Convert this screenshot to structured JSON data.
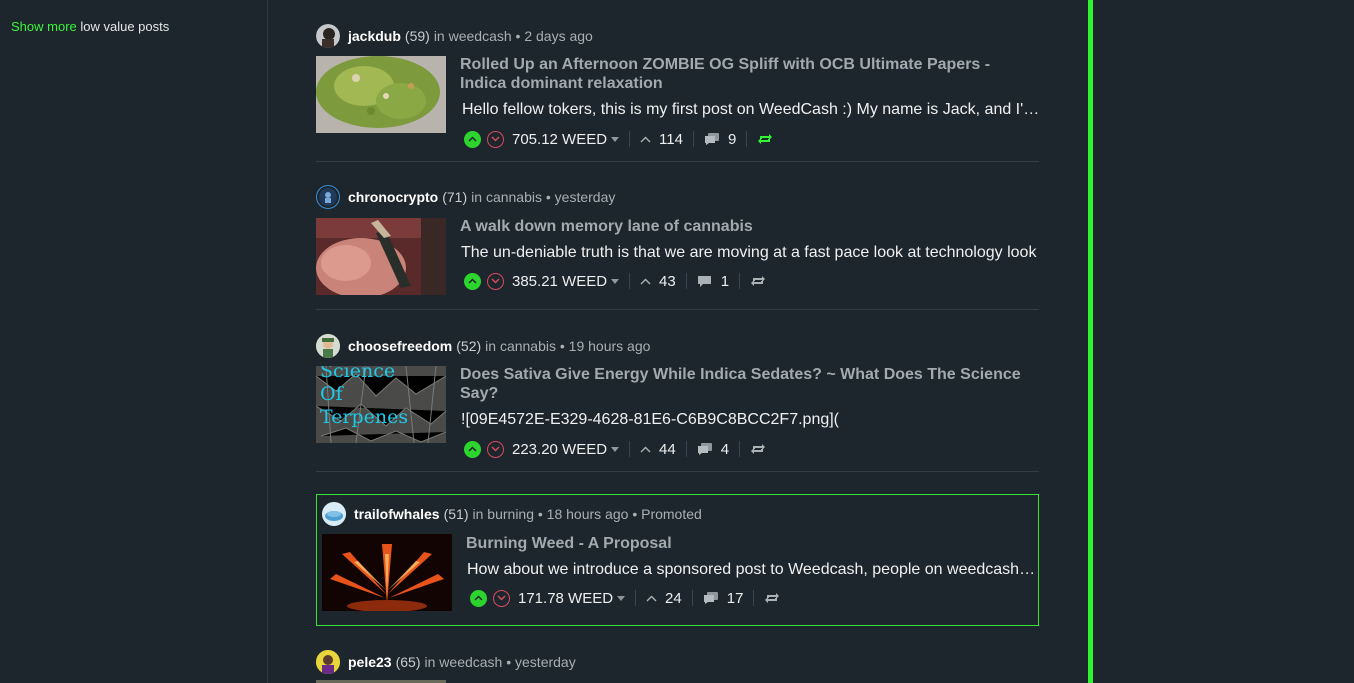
{
  "sidebar": {
    "show_more_link": "Show more",
    "show_more_rest": " low value posts"
  },
  "posts": [
    {
      "author": "jackdub",
      "rep": "(59)",
      "in_label": "in",
      "community": "weedcash",
      "time": "• 2 days ago",
      "title": "Rolled Up an Afternoon ZOMBIE OG Spliff with OCB Ultimate Papers - Indica dominant relaxation",
      "body": "Hello fellow tokers, this is my first post on WeedCash :) My name is Jack, and I'm a",
      "payout": "705.12 WEED",
      "votes": "114",
      "comments": "9",
      "reblogged": true
    },
    {
      "author": "chronocrypto",
      "rep": "(71)",
      "in_label": "in",
      "community": "cannabis",
      "time": "• yesterday",
      "title": "A walk down memory lane of cannabis",
      "body": "The un-deniable truth is that we are moving at a fast pace look at technology look",
      "payout": "385.21 WEED",
      "votes": "43",
      "comments": "1",
      "reblogged": false
    },
    {
      "author": "choosefreedom",
      "rep": "(52)",
      "in_label": "in",
      "community": "cannabis",
      "time": "• 19 hours ago",
      "title": "Does Sativa Give Energy While Indica Sedates? ~ What Does The Science Say?",
      "body": "![09E4572E-E329-4628-81E6-C6B9C8BCC2F7.png](",
      "thumb_text": "Science Of Terpenes",
      "payout": "223.20 WEED",
      "votes": "44",
      "comments": "4",
      "reblogged": false
    },
    {
      "author": "trailofwhales",
      "rep": "(51)",
      "in_label": "in",
      "community": "burning",
      "time": "• 18 hours ago",
      "promoted": "• Promoted",
      "title": "Burning Weed - A Proposal",
      "body": "How about we introduce a sponsored post to Weedcash, people on weedcash can",
      "payout": "171.78 WEED",
      "votes": "24",
      "comments": "17",
      "reblogged": false
    },
    {
      "author": "pele23",
      "rep": "(65)",
      "in_label": "in",
      "community": "weedcash",
      "time": "• yesterday"
    }
  ],
  "colors": {
    "background": "#1c262c",
    "accent_green": "#2ff42f",
    "upvote": "#2ed42e",
    "downvote": "#d64b5e",
    "title": "#a2aaae"
  }
}
